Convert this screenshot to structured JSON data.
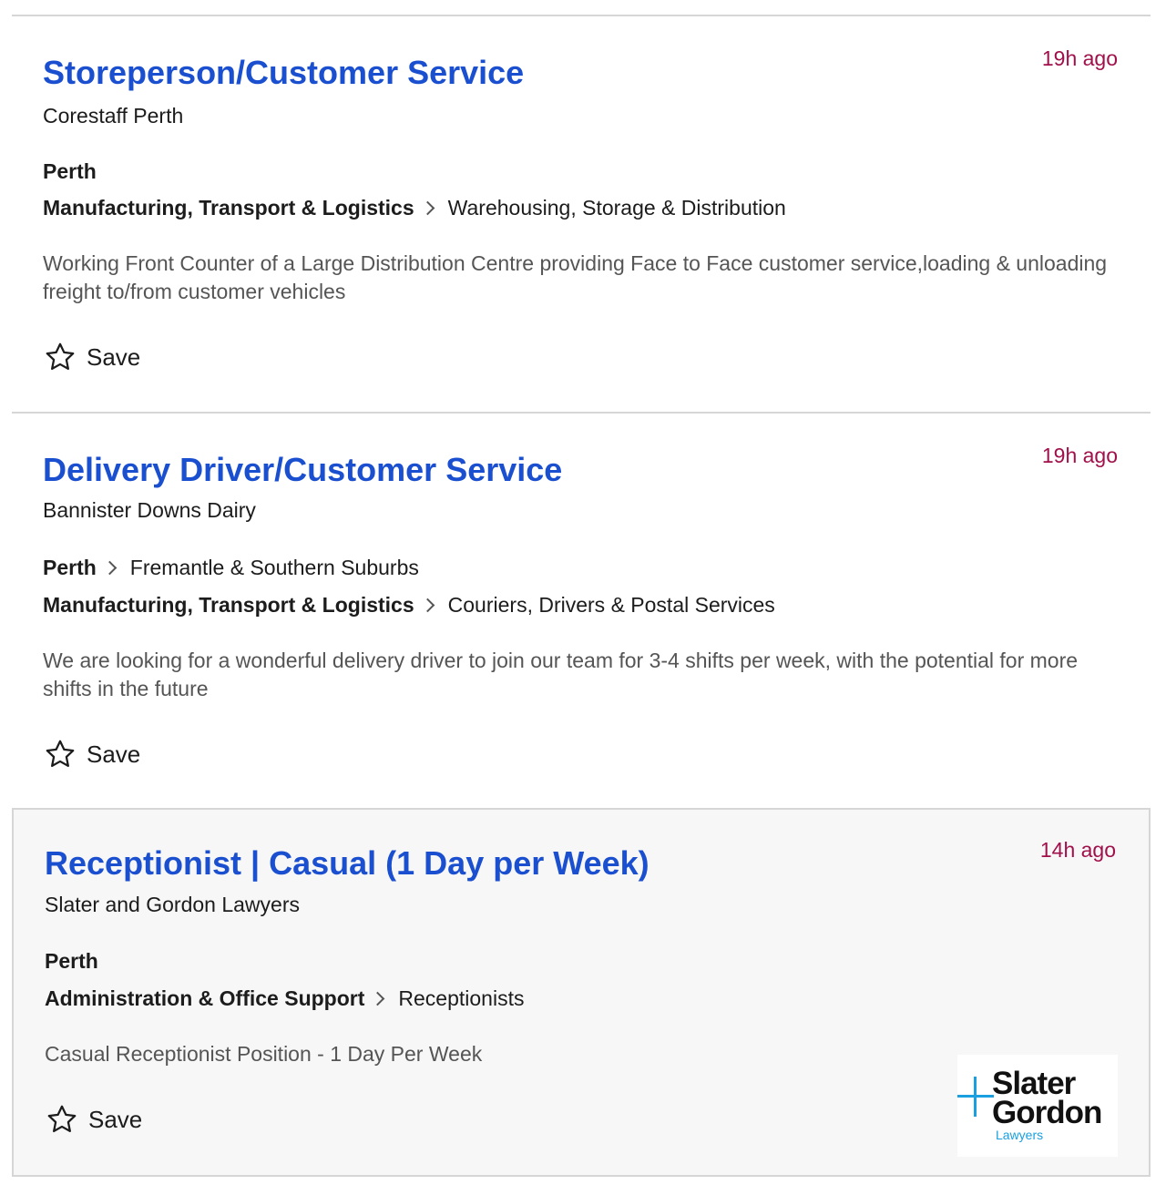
{
  "jobs": [
    {
      "title": "Storeperson/Customer Service",
      "listed": "19h ago",
      "company": "Corestaff Perth",
      "location": "Perth",
      "area": "",
      "classification": "Manufacturing, Transport & Logistics",
      "subclassification": "Warehousing, Storage & Distribution",
      "description": "Working Front Counter of a Large Distribution Centre providing Face to Face customer service,loading & unloading freight to/from customer vehicles",
      "save_label": "Save"
    },
    {
      "title": "Delivery Driver/Customer Service",
      "listed": "19h ago",
      "company": "Bannister Downs Dairy",
      "location": "Perth",
      "area": "Fremantle & Southern Suburbs",
      "classification": "Manufacturing, Transport & Logistics",
      "subclassification": "Couriers, Drivers & Postal Services",
      "description": "We are looking for a wonderful delivery driver to join our team for 3-4 shifts per week, with the potential for more shifts in the future",
      "save_label": "Save"
    },
    {
      "title": "Receptionist | Casual (1 Day per Week)",
      "listed": "14h ago",
      "company": "Slater and Gordon Lawyers",
      "location": "Perth",
      "area": "",
      "classification": "Administration & Office Support",
      "subclassification": "Receptionists",
      "description": "Casual Receptionist Position - 1 Day Per Week",
      "save_label": "Save",
      "logo": {
        "line1": "Slater",
        "line2": "Gordon",
        "line3": "Lawyers",
        "accent_color": "#1aa0e0"
      }
    }
  ],
  "colors": {
    "title": "#1a4fd0",
    "timestamp": "#a0104a",
    "description": "#555555",
    "divider": "#d6d6d6"
  }
}
